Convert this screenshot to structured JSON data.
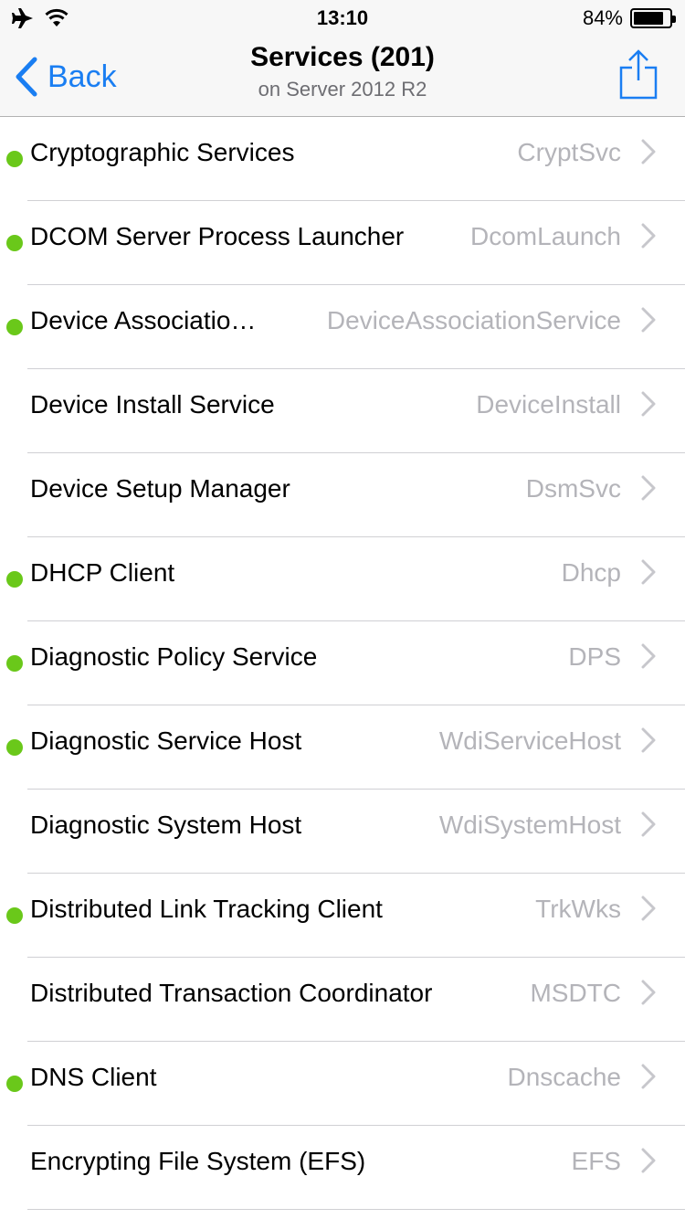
{
  "status_bar": {
    "time": "13:10",
    "battery_percent": "84%",
    "battery_level": 0.84,
    "icons": [
      "airplane-icon",
      "wifi-icon",
      "battery-icon"
    ]
  },
  "nav": {
    "back_label": "Back",
    "title": "Services (201)",
    "subtitle": "on Server 2012 R2",
    "accent_color": "#1a7ef2"
  },
  "status_colors": {
    "running": "#6ac81a"
  },
  "services": [
    {
      "name": "Cryptographic Services",
      "service_name": "CryptSvc",
      "running": true
    },
    {
      "name": "DCOM Server Process Launcher",
      "service_name": "DcomLaunch",
      "running": true
    },
    {
      "name": "Device Associatio…",
      "service_name": "DeviceAssociationService",
      "running": true
    },
    {
      "name": "Device Install Service",
      "service_name": "DeviceInstall",
      "running": false
    },
    {
      "name": "Device Setup Manager",
      "service_name": "DsmSvc",
      "running": false
    },
    {
      "name": "DHCP Client",
      "service_name": "Dhcp",
      "running": true
    },
    {
      "name": "Diagnostic Policy Service",
      "service_name": "DPS",
      "running": true
    },
    {
      "name": "Diagnostic Service Host",
      "service_name": "WdiServiceHost",
      "running": true
    },
    {
      "name": "Diagnostic System Host",
      "service_name": "WdiSystemHost",
      "running": false
    },
    {
      "name": "Distributed Link Tracking Client",
      "service_name": "TrkWks",
      "running": true
    },
    {
      "name": "Distributed Transaction Coordinator",
      "service_name": "MSDTC",
      "running": false
    },
    {
      "name": "DNS Client",
      "service_name": "Dnscache",
      "running": true
    },
    {
      "name": "Encrypting File System (EFS)",
      "service_name": "EFS",
      "running": false
    }
  ]
}
